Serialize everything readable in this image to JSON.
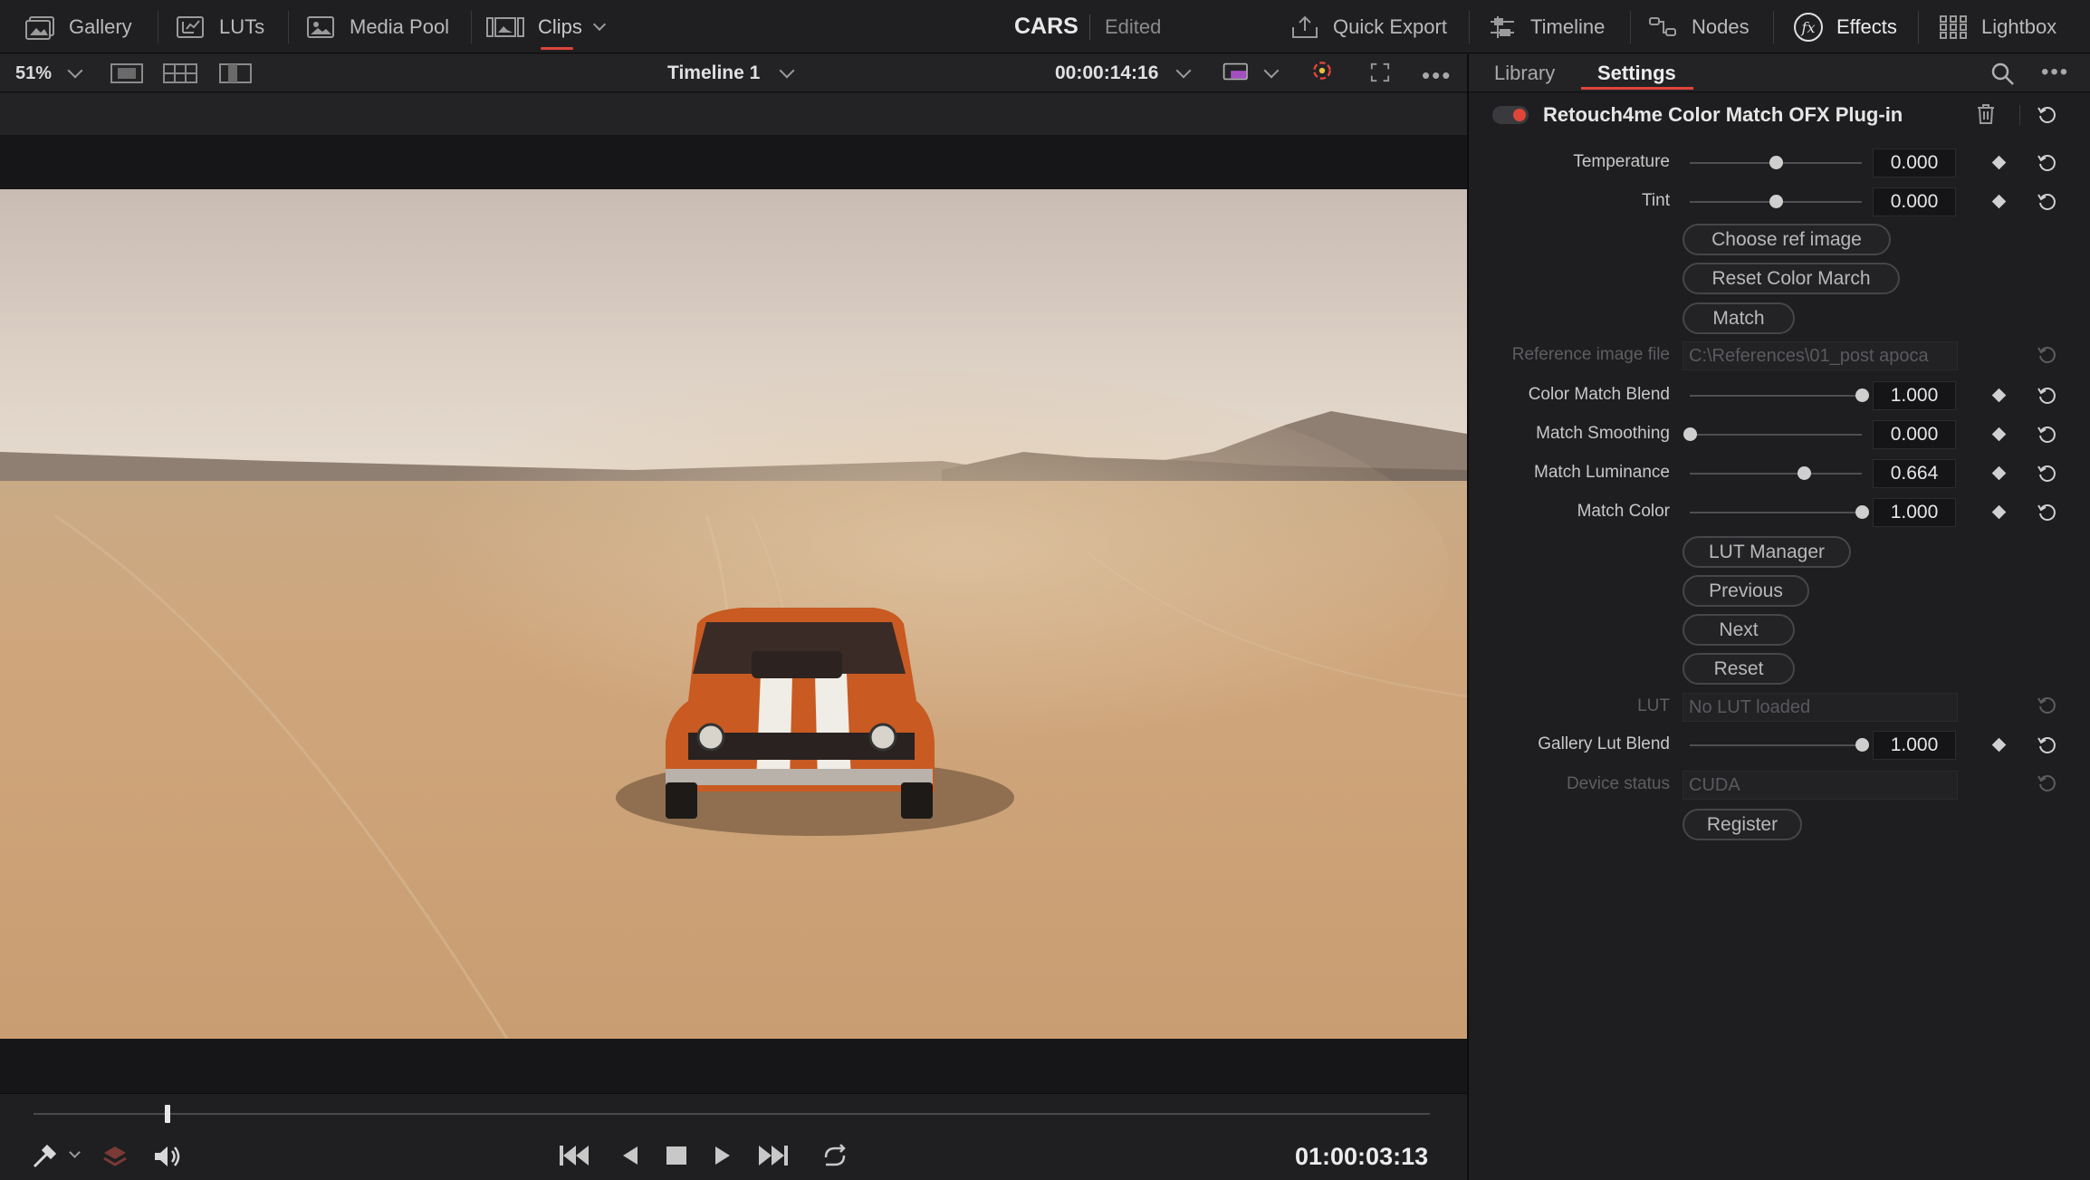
{
  "topbar": {
    "gallery": "Gallery",
    "luts": "LUTs",
    "media_pool": "Media Pool",
    "clips": "Clips",
    "project_name": "CARS",
    "project_status": "Edited",
    "quick_export": "Quick Export",
    "timeline": "Timeline",
    "nodes": "Nodes",
    "effects": "Effects",
    "lightbox": "Lightbox"
  },
  "viewer": {
    "zoom": "51%",
    "timeline_name": "Timeline 1",
    "timecode": "00:00:14:16",
    "more": "•••"
  },
  "inspector": {
    "tabs": [
      "Library",
      "Settings"
    ],
    "active_tab": "Settings",
    "plugin_title": "Retouch4me Color Match OFX Plug-in",
    "params": {
      "temperature": {
        "label": "Temperature",
        "value": "0.000",
        "fraction": 0.5
      },
      "tint": {
        "label": "Tint",
        "value": "0.000",
        "fraction": 0.5
      },
      "color_match_blend": {
        "label": "Color Match Blend",
        "value": "1.000",
        "fraction": 1.0
      },
      "match_smoothing": {
        "label": "Match Smoothing",
        "value": "0.000",
        "fraction": 0.0
      },
      "match_luminance": {
        "label": "Match Luminance",
        "value": "0.664",
        "fraction": 0.664
      },
      "match_color": {
        "label": "Match Color",
        "value": "1.000",
        "fraction": 1.0
      },
      "gallery_lut_blend": {
        "label": "Gallery Lut Blend",
        "value": "1.000",
        "fraction": 1.0
      }
    },
    "buttons": {
      "choose_ref": "Choose ref image",
      "reset_color_match": "Reset Color March",
      "match": "Match",
      "lut_manager": "LUT Manager",
      "previous": "Previous",
      "next": "Next",
      "reset": "Reset",
      "register": "Register"
    },
    "fields": {
      "reference_image_label": "Reference image file",
      "reference_image_value": "C:\\References\\01_post apoca",
      "lut_label": "LUT",
      "lut_value": "No LUT loaded",
      "device_status_label": "Device status",
      "device_status_value": "CUDA"
    }
  },
  "transport": {
    "timecode": "01:00:03:13",
    "playhead_fraction": 0.094
  },
  "colors": {
    "accent": "#e0453a",
    "panel": "#1e1e20",
    "toolbar": "#232326"
  }
}
